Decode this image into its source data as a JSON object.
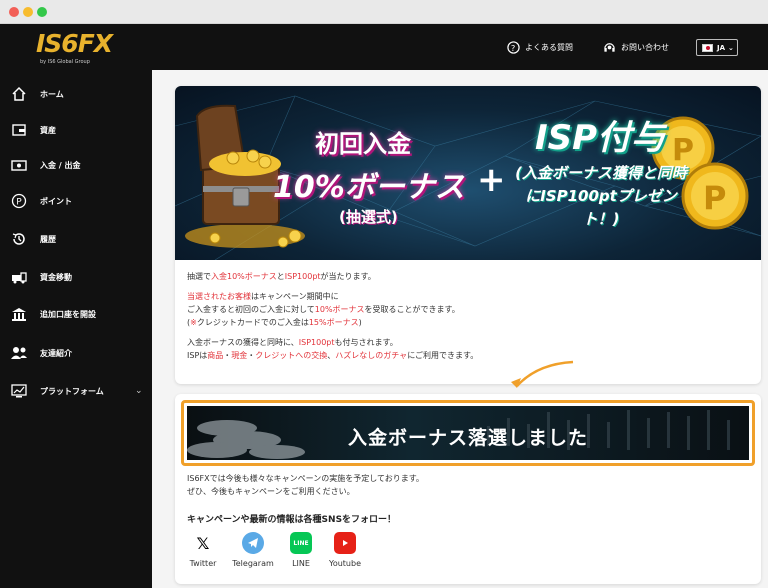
{
  "window": {
    "controls": [
      "close",
      "minimize",
      "maximize"
    ]
  },
  "brand": {
    "logo": "IS6FX",
    "sub": "by IS6 Global Group",
    "accent": "#e8b22d"
  },
  "header": {
    "faq_label": "よくある質問",
    "contact_label": "お問い合わせ",
    "language": "JA"
  },
  "sidebar": {
    "items": [
      {
        "label": "ホーム",
        "icon": "home-icon"
      },
      {
        "label": "資産",
        "icon": "wallet-icon"
      },
      {
        "label": "入金 / 出金",
        "icon": "cash-icon"
      },
      {
        "label": "ポイント",
        "icon": "point-icon"
      },
      {
        "label": "履歴",
        "icon": "history-icon"
      },
      {
        "label": "資金移動",
        "icon": "transfer-icon"
      },
      {
        "label": "追加口座を開設",
        "icon": "bank-icon"
      },
      {
        "label": "友達紹介",
        "icon": "users-icon"
      },
      {
        "label": "プラットフォーム",
        "icon": "chart-icon"
      }
    ]
  },
  "banner": {
    "line1": "初回入金",
    "line2": "10%ボーナス",
    "line3": "(抽選式)",
    "plus": "+",
    "isp": "ISP付与",
    "isp_sub": "(入金ボーナス獲得と同時にISP100ptプレゼント！)"
  },
  "campaign": {
    "p1_a": "抽選で",
    "p1_b": "入金10%ボーナス",
    "p1_c": "と",
    "p1_d": "ISP100pt",
    "p1_e": "が当たります。",
    "p2_a": "当選されたお客様",
    "p2_b": "はキャンペーン期間中に",
    "p2_c": "ご入金すると初回のご入金に対して",
    "p2_d": "10%ボーナス",
    "p2_e": "を受取ることができます。",
    "p2_f": "(",
    "p2_g": "※",
    "p2_h": "クレジットカードでのご入金は",
    "p2_i": "15%ボーナス",
    "p2_j": ")",
    "p3_a": "入金ボーナスの獲得と同時に、",
    "p3_b": "ISP100pt",
    "p3_c": "も付与されます。",
    "p3_d": "ISPは",
    "p3_e": "商品",
    "p3_f": "・",
    "p3_g": "現金",
    "p3_h": "・",
    "p3_i": "クレジットへの交換",
    "p3_j": "、",
    "p3_k": "ハズレなしのガチャ",
    "p3_l": "にご利用できます。"
  },
  "result": {
    "message": "入金ボーナス落選しました",
    "info1": "IS6FXでは今後も様々なキャンペーンの実施を予定しております。",
    "info2": "ぜひ、今後もキャンペーンをご利用ください。",
    "sns_title": "キャンペーンや最新の情報は各種SNSをフォロー！",
    "sns": [
      {
        "label": "Twitter",
        "icon": "x-icon",
        "color": "#000000"
      },
      {
        "label": "Telegaram",
        "icon": "telegram-icon",
        "color": "#5aa9e6"
      },
      {
        "label": "LINE",
        "icon": "line-icon",
        "color": "#06c755"
      },
      {
        "label": "Youtube",
        "icon": "youtube-icon",
        "color": "#e62117"
      }
    ]
  },
  "colors": {
    "highlight": "#e2333a",
    "outline": "#f0a02a",
    "sidebar_bg": "#111111"
  }
}
